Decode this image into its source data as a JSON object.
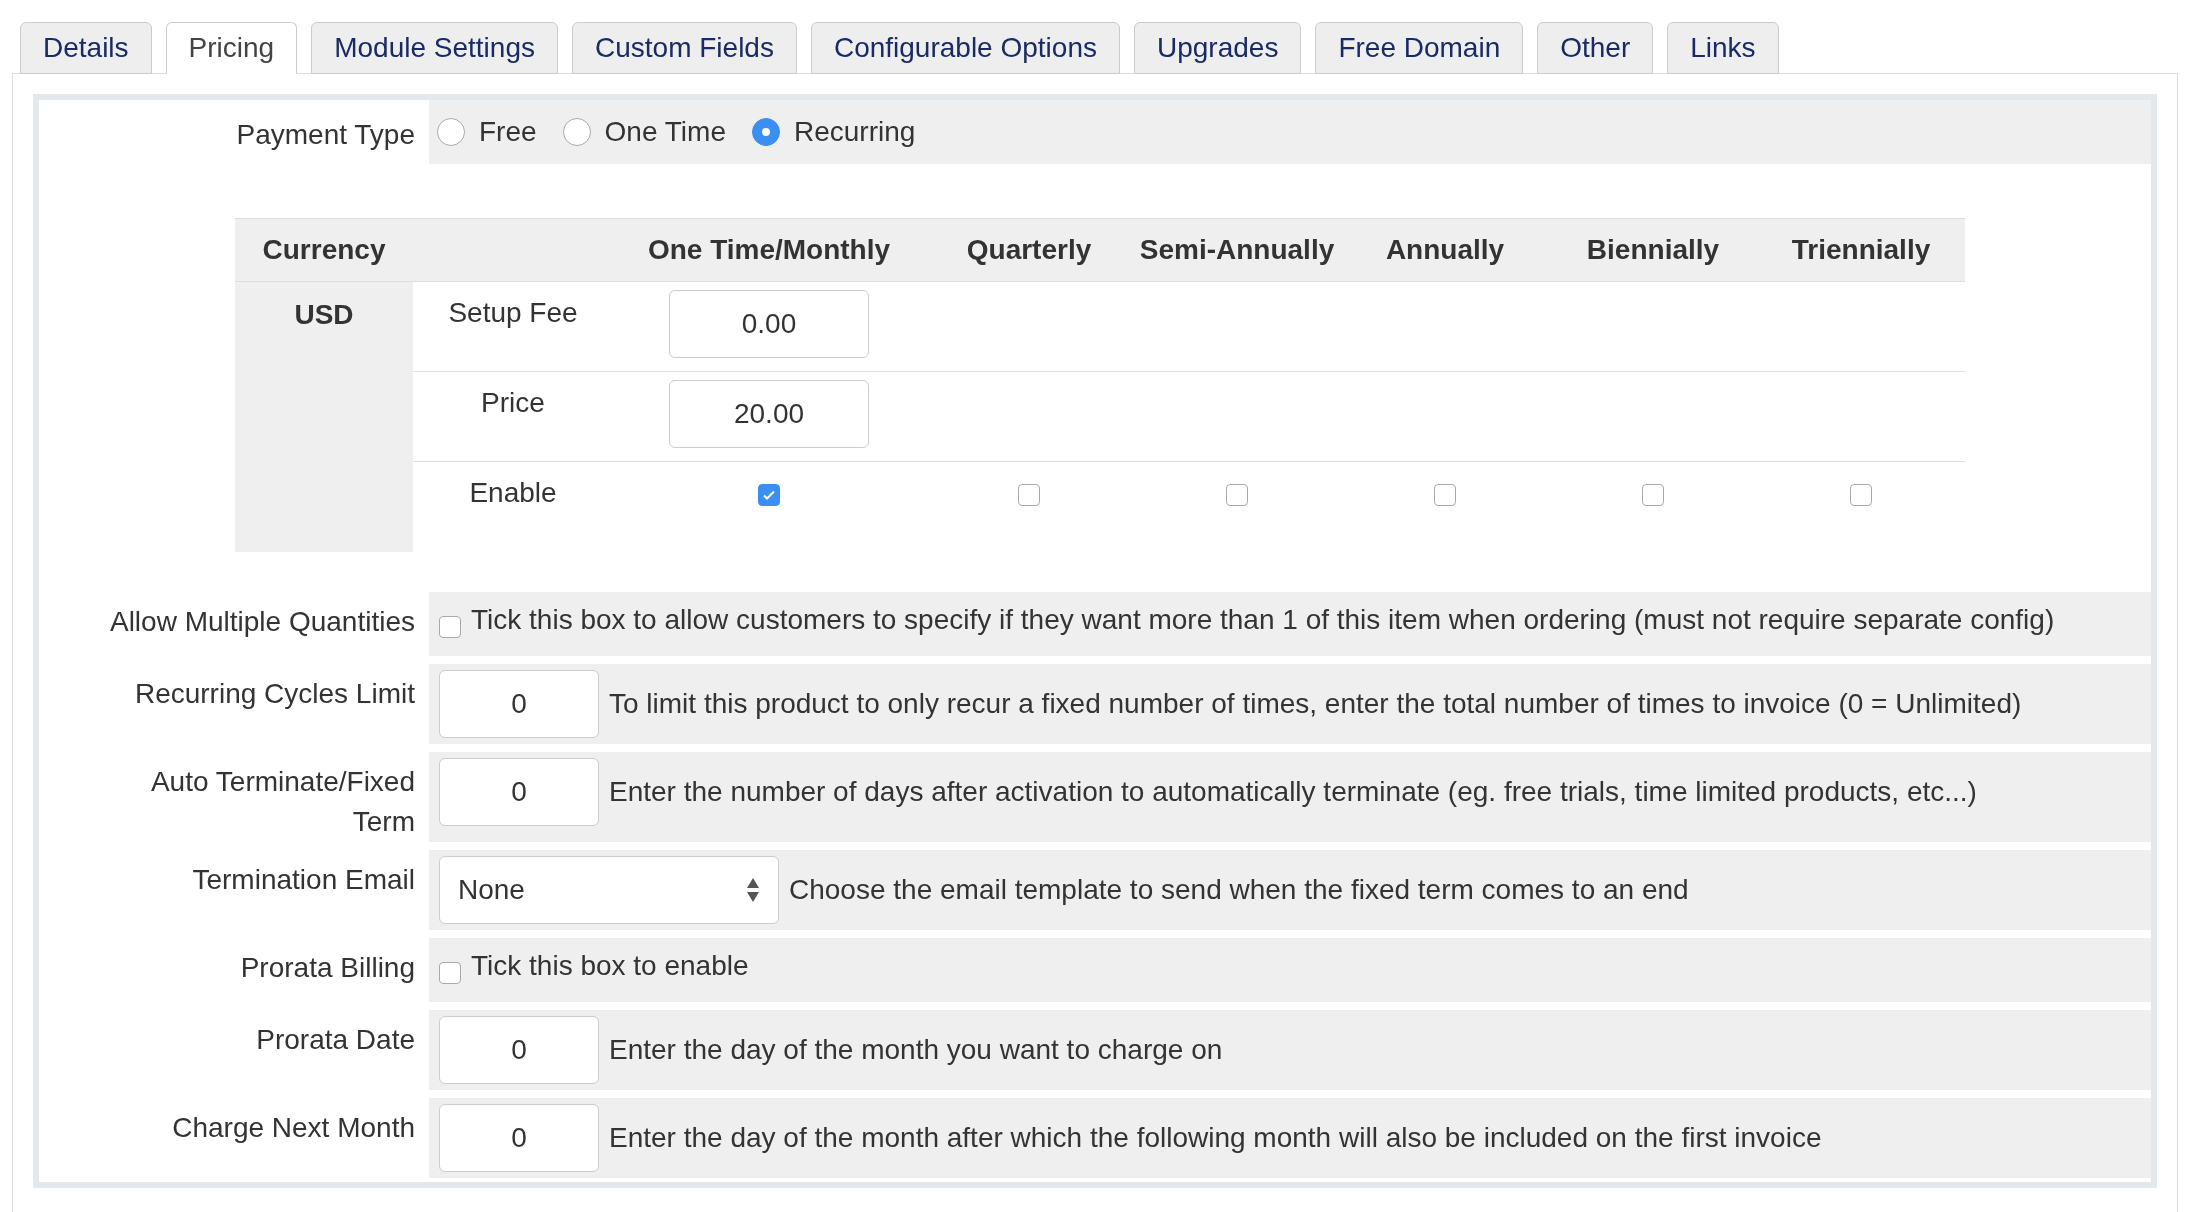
{
  "tabs": [
    {
      "label": "Details",
      "selected": false
    },
    {
      "label": "Pricing",
      "selected": true
    },
    {
      "label": "Module Settings",
      "selected": false
    },
    {
      "label": "Custom Fields",
      "selected": false
    },
    {
      "label": "Configurable Options",
      "selected": false
    },
    {
      "label": "Upgrades",
      "selected": false
    },
    {
      "label": "Free Domain",
      "selected": false
    },
    {
      "label": "Other",
      "selected": false
    },
    {
      "label": "Links",
      "selected": false
    }
  ],
  "payment_type": {
    "label": "Payment Type",
    "options": [
      {
        "label": "Free",
        "selected": false
      },
      {
        "label": "One Time",
        "selected": false
      },
      {
        "label": "Recurring",
        "selected": true
      }
    ]
  },
  "pricing_table": {
    "columns": [
      "Currency",
      "One Time/Monthly",
      "Quarterly",
      "Semi-Annually",
      "Annually",
      "Biennially",
      "Triennially"
    ],
    "currency": "USD",
    "rows": [
      {
        "kind": "input",
        "label": "Setup Fee",
        "values": [
          "0.00"
        ]
      },
      {
        "kind": "input",
        "label": "Price",
        "values": [
          "20.00"
        ]
      },
      {
        "kind": "checkbox",
        "label": "Enable",
        "checks": [
          {
            "checked": true
          },
          {
            "checked": false
          },
          {
            "checked": false
          },
          {
            "checked": false
          },
          {
            "checked": false
          },
          {
            "checked": false
          }
        ]
      }
    ]
  },
  "options": [
    {
      "kind": "checkbox",
      "label": "Allow Multiple Quantities",
      "checked": false,
      "description": "Tick this box to allow customers to specify if they want more than 1 of this item when ordering (must not require separate config)"
    },
    {
      "kind": "input",
      "label": "Recurring Cycles Limit",
      "value": "0",
      "description": "To limit this product to only recur a fixed number of times, enter the total number of times to invoice (0 = Unlimited)"
    },
    {
      "kind": "input",
      "label": "Auto Terminate/Fixed Term",
      "value": "0",
      "description": "Enter the number of days after activation to automatically terminate (eg. free trials, time limited products, etc...)"
    },
    {
      "kind": "select",
      "label": "Termination Email",
      "value": "None",
      "description": "Choose the email template to send when the fixed term comes to an end"
    },
    {
      "kind": "checkbox",
      "label": "Prorata Billing",
      "checked": false,
      "description": "Tick this box to enable"
    },
    {
      "kind": "input",
      "label": "Prorata Date",
      "value": "0",
      "description": "Enter the day of the month you want to charge on"
    },
    {
      "kind": "input",
      "label": "Charge Next Month",
      "value": "0",
      "description": "Enter the day of the month after which the following month will also be included on the first invoice"
    }
  ]
}
